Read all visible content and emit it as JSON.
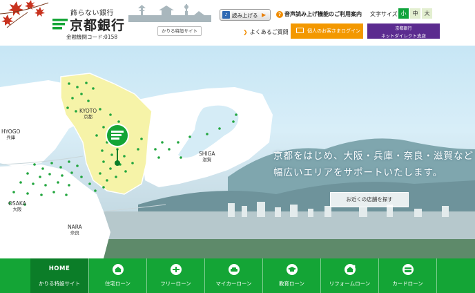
{
  "header": {
    "tagline": "飾らない銀行",
    "bank_name": "京都銀行",
    "bank_code": "金融機関コード:0158",
    "karu_site_button": "かりる特設サイト",
    "read_aloud_button": "読み上げる",
    "voice_guide": "音声読み上げ機能のご利用案内",
    "font_size_label": "文字サイズ",
    "font_size_options": [
      "小",
      "中",
      "大"
    ],
    "faq": "よくあるご質問",
    "login_button": "個人のお客さまログイン",
    "direct_branch": {
      "line1": "京都銀行",
      "line2": "ネットダイレクト支店"
    }
  },
  "hero": {
    "map_labels": {
      "kyoto": {
        "en": "KYOTO",
        "jp": "京都"
      },
      "hyogo": {
        "en": "HYOGO",
        "jp": "兵庫"
      },
      "shiga": {
        "en": "SHIGA",
        "jp": "滋賀"
      },
      "osaka": {
        "en": "OSAKA",
        "jp": "大阪"
      },
      "nara": {
        "en": "NARA",
        "jp": "奈良"
      }
    },
    "headline_line1": "京都をはじめ、大阪・兵庫・奈良・滋賀など",
    "headline_line2": "幅広いエリアをサポートいたします。",
    "find_store_button": "お近くの店舗を探す"
  },
  "nav": {
    "home_title": "HOME",
    "home_label": "かりる特設サイト",
    "items": [
      {
        "label": "住宅ローン",
        "icon": "house-icon"
      },
      {
        "label": "フリーローン",
        "icon": "free-icon"
      },
      {
        "label": "マイカーローン",
        "icon": "car-icon"
      },
      {
        "label": "教育ローン",
        "icon": "graduation-cap-icon"
      },
      {
        "label": "リフォームローン",
        "icon": "renovation-house-icon"
      },
      {
        "label": "カードローン",
        "icon": "card-icon"
      }
    ]
  },
  "colors": {
    "brand_green": "#14a536",
    "dark_green": "#0b7d28",
    "orange": "#f39800",
    "purple": "#5b2b8f",
    "kyoto_region": "#f6f3a8"
  }
}
